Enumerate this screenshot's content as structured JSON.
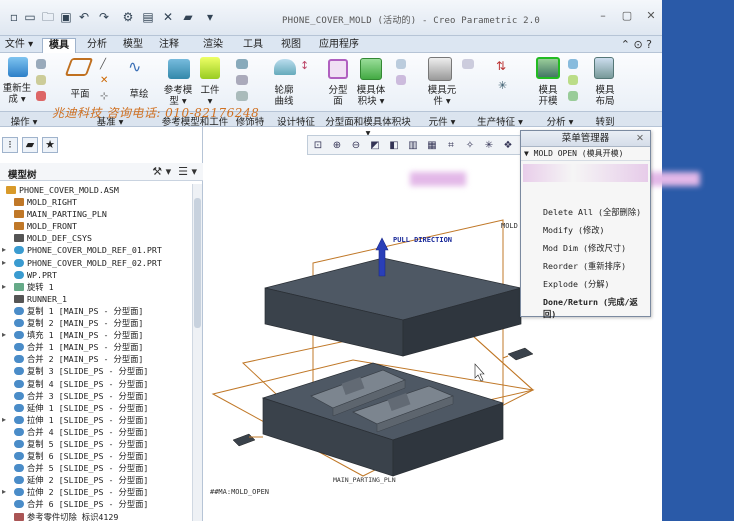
{
  "window": {
    "title": "PHONE_COVER_MOLD (活动的) - Creo Parametric 2.0"
  },
  "tabs": [
    {
      "label": "文件 ▾"
    },
    {
      "label": "模具"
    },
    {
      "label": "分析"
    },
    {
      "label": "模型"
    },
    {
      "label": "注释"
    },
    {
      "label": "渲染"
    },
    {
      "label": "工具"
    },
    {
      "label": "视图"
    },
    {
      "label": "应用程序"
    }
  ],
  "ribbon": {
    "regenerate": "重新生\n成 ▾",
    "plane": "平面",
    "sketch": "草绘",
    "ref_model": "参考模\n型 ▾",
    "workpiece": "工件\n▾",
    "contour": "轮廓\n曲线",
    "parting_surface": "分型\n面",
    "mold_volume": "模具体\n积块 ▾",
    "mold_component": "模具元\n件 ▾",
    "mold_open": "模具\n开模",
    "mold_layout": "模具\n布局"
  },
  "groups": [
    {
      "label": "操作 ▾"
    },
    {
      "label": "基准 ▾"
    },
    {
      "label": "参考模型和工件"
    },
    {
      "label": "修饰特"
    },
    {
      "label": "设计特征"
    },
    {
      "label": "分型面和模具体积块 ▾"
    },
    {
      "label": "元件 ▾"
    },
    {
      "label": "生产特征 ▾"
    },
    {
      "label": "分析 ▾"
    },
    {
      "label": "转到"
    }
  ],
  "watermark": {
    "text": "兆迪科技 咨询电话: 010-82176248"
  },
  "tree": {
    "header": "模型树",
    "items": [
      {
        "label": "PHONE_COVER_MOLD.ASM",
        "exp": "",
        "indent": 0,
        "icon": "assembly-icon"
      },
      {
        "label": "MOLD_RIGHT",
        "exp": "",
        "indent": 1,
        "icon": "datum-plane-icon"
      },
      {
        "label": "MAIN_PARTING_PLN",
        "exp": "",
        "indent": 1,
        "icon": "datum-plane-icon"
      },
      {
        "label": "MOLD_FRONT",
        "exp": "",
        "indent": 1,
        "icon": "datum-plane-icon"
      },
      {
        "label": "MOLD_DEF_CSYS",
        "exp": "",
        "indent": 1,
        "icon": "csys-icon"
      },
      {
        "label": "PHONE_COVER_MOLD_REF_01.PRT",
        "exp": "▸",
        "indent": 1,
        "icon": "part-icon"
      },
      {
        "label": "PHONE_COVER_MOLD_REF_02.PRT",
        "exp": "▸",
        "indent": 1,
        "icon": "part-icon"
      },
      {
        "label": "WP.PRT",
        "exp": "",
        "indent": 1,
        "icon": "part-icon"
      },
      {
        "label": "旋转 1",
        "exp": "▸",
        "indent": 1,
        "icon": "revolve-icon"
      },
      {
        "label": "RUNNER_1",
        "exp": "",
        "indent": 1,
        "icon": "csys-icon"
      },
      {
        "label": "复制 1 [MAIN_PS - 分型面]",
        "exp": "",
        "indent": 1,
        "icon": "surface-icon"
      },
      {
        "label": "复制 2 [MAIN_PS - 分型面]",
        "exp": "",
        "indent": 1,
        "icon": "surface-icon"
      },
      {
        "label": "填充 1 [MAIN_PS - 分型面]",
        "exp": "▸",
        "indent": 1,
        "icon": "surface-icon"
      },
      {
        "label": "合并 1 [MAIN_PS - 分型面]",
        "exp": "",
        "indent": 1,
        "icon": "surface-icon"
      },
      {
        "label": "合并 2 [MAIN_PS - 分型面]",
        "exp": "",
        "indent": 1,
        "icon": "surface-icon"
      },
      {
        "label": "复制 3 [SLIDE_PS - 分型面]",
        "exp": "",
        "indent": 1,
        "icon": "surface-icon"
      },
      {
        "label": "复制 4 [SLIDE_PS - 分型面]",
        "exp": "",
        "indent": 1,
        "icon": "surface-icon"
      },
      {
        "label": "合并 3 [SLIDE_PS - 分型面]",
        "exp": "",
        "indent": 1,
        "icon": "surface-icon"
      },
      {
        "label": "延伸 1 [SLIDE_PS - 分型面]",
        "exp": "",
        "indent": 1,
        "icon": "surface-icon"
      },
      {
        "label": "拉伸 1 [SLIDE_PS - 分型面]",
        "exp": "▸",
        "indent": 1,
        "icon": "surface-icon"
      },
      {
        "label": "合并 4 [SLIDE_PS - 分型面]",
        "exp": "",
        "indent": 1,
        "icon": "surface-icon"
      },
      {
        "label": "复制 5 [SLIDE_PS - 分型面]",
        "exp": "",
        "indent": 1,
        "icon": "surface-icon"
      },
      {
        "label": "复制 6 [SLIDE_PS - 分型面]",
        "exp": "",
        "indent": 1,
        "icon": "surface-icon"
      },
      {
        "label": "合并 5 [SLIDE_PS - 分型面]",
        "exp": "",
        "indent": 1,
        "icon": "surface-icon"
      },
      {
        "label": "延伸 2 [SLIDE_PS - 分型面]",
        "exp": "",
        "indent": 1,
        "icon": "surface-icon"
      },
      {
        "label": "拉伸 2 [SLIDE_PS - 分型面]",
        "exp": "▸",
        "indent": 1,
        "icon": "surface-icon"
      },
      {
        "label": "合并 6 [SLIDE_PS - 分型面]",
        "exp": "",
        "indent": 1,
        "icon": "surface-icon"
      },
      {
        "label": "参考零件切除  标识4129",
        "exp": "",
        "indent": 1,
        "icon": "cut-icon"
      }
    ]
  },
  "menu_manager": {
    "title": "菜单管理器",
    "section": "▼ MOLD OPEN (模具开模)",
    "items": [
      {
        "label": "Delete All (全部删除)",
        "bold": false
      },
      {
        "label": "Modify (修改)",
        "bold": false
      },
      {
        "label": "Mod Dim (修改尺寸)",
        "bold": false
      },
      {
        "label": "Reorder (重新排序)",
        "bold": false
      },
      {
        "label": "Explode (分解)",
        "bold": false
      },
      {
        "label": "Done/Return (完成/返回)",
        "bold": true
      }
    ]
  },
  "scene": {
    "pull_direction": "PULL DIRECTION",
    "mold_label": "MOLD",
    "parting_plane": "MAIN_PARTING_PLN",
    "status": "##MA:MOLD_OPEN"
  },
  "colors": {
    "accent": "#2a5aa8",
    "mold": "#3d4650",
    "frame": "#c07828"
  }
}
